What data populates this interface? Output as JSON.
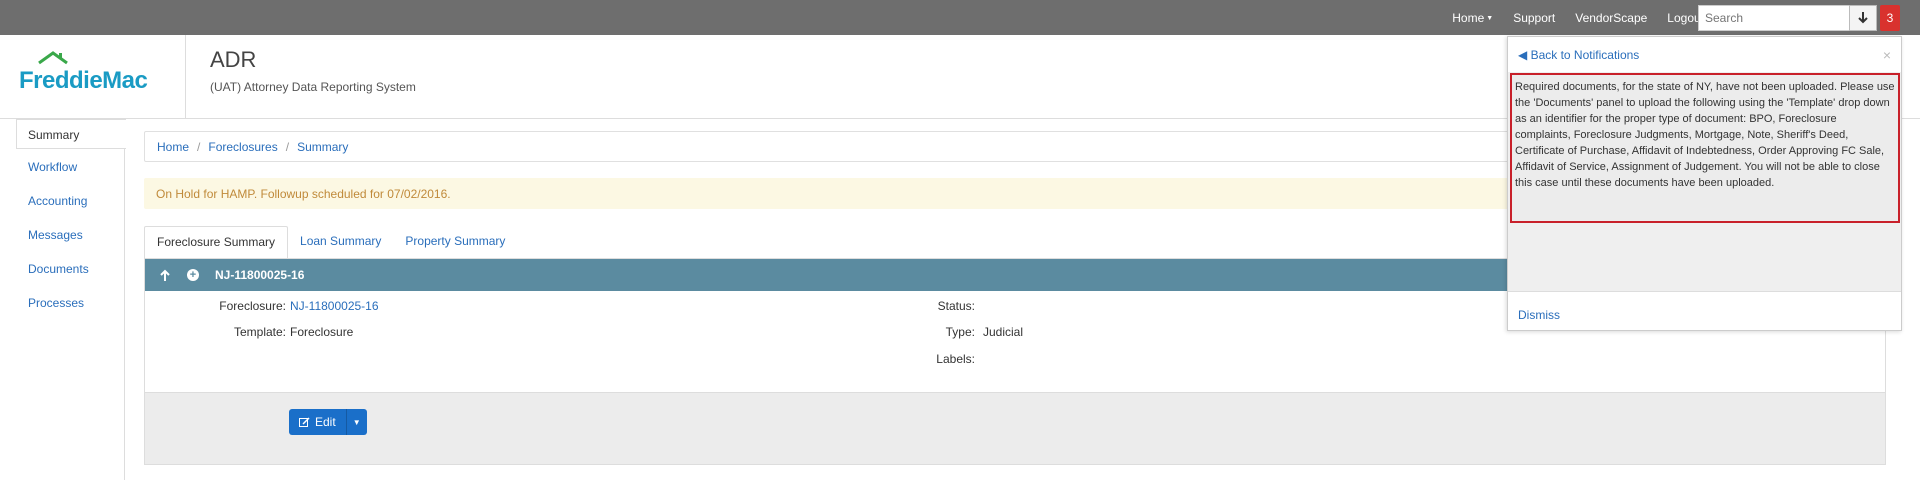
{
  "topnav": {
    "home": "Home",
    "support": "Support",
    "vendorscape": "VendorScape",
    "logout": "Logout",
    "search_placeholder": "Search",
    "notification_count": "3"
  },
  "header": {
    "logo": "FreddieMac",
    "title": "ADR",
    "subtitle": "(UAT) Attorney Data Reporting System"
  },
  "sidebar": {
    "items": [
      {
        "label": "Summary"
      },
      {
        "label": "Workflow"
      },
      {
        "label": "Accounting"
      },
      {
        "label": "Messages"
      },
      {
        "label": "Documents"
      },
      {
        "label": "Processes"
      }
    ]
  },
  "breadcrumb": [
    "Home",
    "Foreclosures",
    "Summary"
  ],
  "alert": "On Hold for HAMP. Followup scheduled for 07/02/2016.",
  "tabs": [
    "Foreclosure Summary",
    "Loan Summary",
    "Property Summary"
  ],
  "panel": {
    "title": "NJ-11800025-16",
    "fields": {
      "foreclosure_label": "Foreclosure:",
      "foreclosure_value": "NJ-11800025-16",
      "template_label": "Template:",
      "template_value": "Foreclosure",
      "status_label": "Status:",
      "status_value": "",
      "type_label": "Type:",
      "type_value": "Judicial",
      "labels_label": "Labels:",
      "labels_value": ""
    },
    "edit_label": "Edit"
  },
  "notification": {
    "back": "Back to Notifications",
    "message": "Required documents, for the state of NY, have not been uploaded. Please use the 'Documents' panel to upload the following using the 'Template' drop down as an identifier for the proper type of document: BPO, Foreclosure complaints, Foreclosure Judgments, Mortgage, Note, Sheriff's Deed, Certificate of Purchase, Affidavit of Indebtedness, Order Approving FC Sale, Affidavit of Service, Assignment of Judgement. You will not be able to close this case until these documents have been uploaded.",
    "dismiss": "Dismiss"
  },
  "colors": {
    "topbar": "#6e6e6e",
    "link": "#2a6ebb",
    "panel_header": "#5b8ba0",
    "badge": "#d9322e",
    "alert_bg": "#fcf8e3",
    "highlight_border": "#c8202a"
  }
}
